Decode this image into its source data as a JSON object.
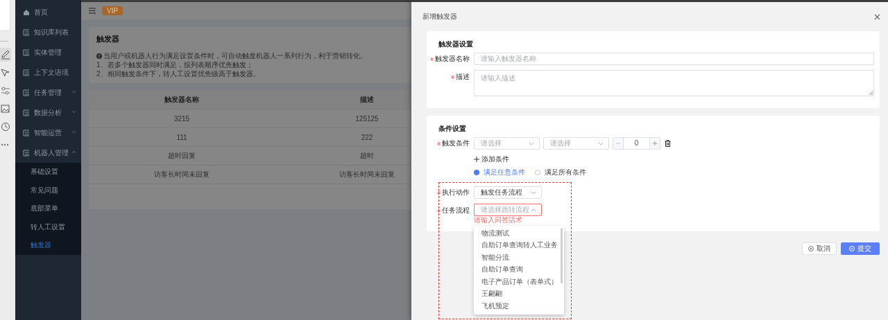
{
  "tool_strip": {
    "tools": [
      {
        "kind": "pen",
        "selected": true
      },
      {
        "kind": "pointer",
        "selected": false
      },
      {
        "kind": "sliders",
        "selected": false
      },
      {
        "kind": "image",
        "selected": false
      },
      {
        "kind": "clock",
        "selected": false
      },
      {
        "kind": "more",
        "selected": false
      }
    ]
  },
  "sidebar": {
    "items": [
      {
        "kind": "home",
        "label": "首页"
      },
      {
        "kind": "link",
        "label": "知识库列表"
      },
      {
        "kind": "link",
        "label": "实体管理"
      },
      {
        "kind": "link",
        "label": "上下文语境"
      },
      {
        "kind": "group",
        "label": "任务管理",
        "expanded": false
      },
      {
        "kind": "group",
        "label": "数据分析",
        "expanded": false
      },
      {
        "kind": "group",
        "label": "智能运营",
        "expanded": false
      },
      {
        "kind": "group",
        "label": "机器人管理",
        "expanded": true,
        "children": [
          {
            "label": "基础设置",
            "selected": false
          },
          {
            "label": "常见问题",
            "selected": false
          },
          {
            "label": "底部菜单",
            "selected": false
          },
          {
            "label": "转人工设置",
            "selected": false
          },
          {
            "label": "触发器",
            "selected": true
          }
        ]
      }
    ]
  },
  "header": {
    "badge": "VIP"
  },
  "notice": {
    "title": "触发器",
    "lines": [
      "当用户或机器人行为满足设置条件时，可自动触发机器人一系列行为，利于营销转化。",
      "1、若多个触发器同时满足，按列表顺序优先触发；",
      "2、相同触发条件下，转人工设置优先级高于触发器。"
    ]
  },
  "table": {
    "columns": [
      "触发器名称",
      "描述"
    ],
    "rows": [
      [
        "3215",
        "125125"
      ],
      [
        "111",
        "222"
      ],
      [
        "超时回复",
        "超时"
      ],
      [
        "访客长时间未回复",
        "访客长时间未回复"
      ]
    ]
  },
  "drawer": {
    "title": "新增触发器",
    "trigger_settings": {
      "title": "触发器设置",
      "fields": [
        {
          "kind": "input",
          "label": "触发器名称",
          "required": true,
          "placeholder": "请输入触发器名称"
        },
        {
          "kind": "textarea",
          "label": "描述",
          "required": true,
          "placeholder": "请输入描述"
        }
      ]
    },
    "condition_settings": {
      "title": "条件设置",
      "condition": {
        "label": "触发条件",
        "required": true,
        "selects": [
          {
            "placeholder": "请选择"
          },
          {
            "placeholder": "请选择"
          }
        ],
        "number": "0"
      },
      "add_condition": "添加条件",
      "match_options": [
        {
          "label": "满足任意条件",
          "selected": true
        },
        {
          "label": "满足所有条件",
          "selected": false
        }
      ],
      "action": {
        "label": "执行动作",
        "required": true,
        "value": "触发任务流程"
      },
      "flow": {
        "label": "任务流程",
        "required": true,
        "placeholder": "请选择跳转流程",
        "error": "请输入问答话术",
        "expanded": true,
        "options": [
          "物流测试",
          "自助订单查询转人工业务",
          "智能分流",
          "自助订单查询",
          "电子产品订单（表单式）",
          "王翩翩",
          "飞机预定"
        ]
      }
    },
    "buttons": [
      {
        "kind": "default",
        "label": "取消"
      },
      {
        "kind": "primary",
        "label": "提交"
      }
    ]
  },
  "annotations": [
    {
      "kind": "dashed-box"
    }
  ]
}
